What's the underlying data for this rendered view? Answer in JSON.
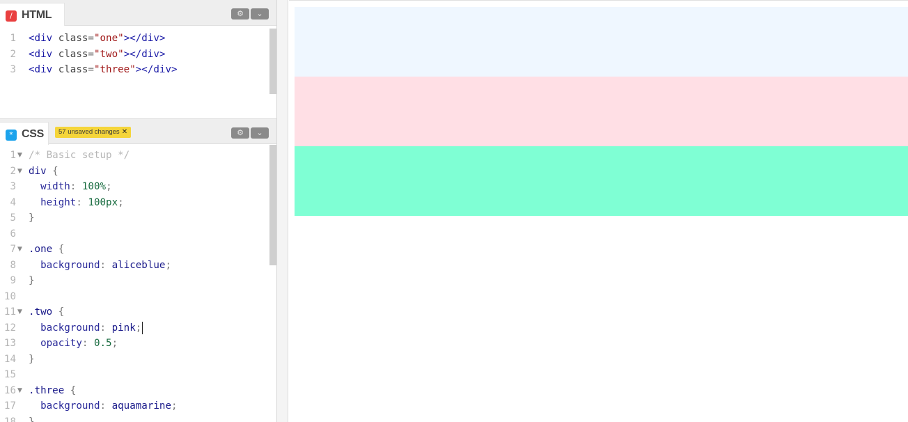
{
  "html_pane": {
    "tab_label": "HTML",
    "icon_glyph": "/",
    "icon_color": "#e94040",
    "settings_glyph": "⚙",
    "collapse_glyph": "⌄",
    "lines": [
      {
        "n": "1",
        "parts": [
          [
            "t-tag",
            "<div"
          ],
          [
            "t-attr",
            " class"
          ],
          [
            "t-pun",
            "="
          ],
          [
            "t-str",
            "\"one\""
          ],
          [
            "t-tag",
            "></div>"
          ]
        ]
      },
      {
        "n": "2",
        "parts": [
          [
            "t-tag",
            "<div"
          ],
          [
            "t-attr",
            " class"
          ],
          [
            "t-pun",
            "="
          ],
          [
            "t-str",
            "\"two\""
          ],
          [
            "t-tag",
            "></div>"
          ]
        ]
      },
      {
        "n": "3",
        "parts": [
          [
            "t-tag",
            "<div"
          ],
          [
            "t-attr",
            " class"
          ],
          [
            "t-pun",
            "="
          ],
          [
            "t-str",
            "\"three\""
          ],
          [
            "t-tag",
            "></div>"
          ]
        ]
      }
    ]
  },
  "css_pane": {
    "tab_label": "CSS",
    "icon_glyph": "*",
    "icon_color": "#1ca3ec",
    "unsaved_badge": "57 unsaved changes",
    "badge_close": "✕",
    "settings_glyph": "⚙",
    "collapse_glyph": "⌄",
    "fold_glyph": "▼",
    "lines": [
      {
        "n": "1",
        "fold": true,
        "parts": [
          [
            "t-cmt",
            "/* Basic setup */"
          ]
        ]
      },
      {
        "n": "2",
        "fold": true,
        "parts": [
          [
            "t-sel",
            "div"
          ],
          [
            "t-pun",
            " {"
          ]
        ]
      },
      {
        "n": "3",
        "parts": [
          [
            "t-prop",
            "  width"
          ],
          [
            "t-pun",
            ": "
          ],
          [
            "t-num",
            "100%"
          ],
          [
            "t-pun",
            ";"
          ]
        ]
      },
      {
        "n": "4",
        "parts": [
          [
            "t-prop",
            "  height"
          ],
          [
            "t-pun",
            ": "
          ],
          [
            "t-num",
            "100px"
          ],
          [
            "t-pun",
            ";"
          ]
        ]
      },
      {
        "n": "5",
        "parts": [
          [
            "t-pun",
            "}"
          ]
        ]
      },
      {
        "n": "6",
        "parts": []
      },
      {
        "n": "7",
        "fold": true,
        "parts": [
          [
            "t-sel",
            ".one"
          ],
          [
            "t-pun",
            " {"
          ]
        ]
      },
      {
        "n": "8",
        "parts": [
          [
            "t-prop",
            "  background"
          ],
          [
            "t-pun",
            ": "
          ],
          [
            "t-val",
            "aliceblue"
          ],
          [
            "t-pun",
            ";"
          ]
        ]
      },
      {
        "n": "9",
        "parts": [
          [
            "t-pun",
            "}"
          ]
        ]
      },
      {
        "n": "10",
        "parts": []
      },
      {
        "n": "11",
        "fold": true,
        "parts": [
          [
            "t-sel",
            ".two"
          ],
          [
            "t-pun",
            " {"
          ]
        ]
      },
      {
        "n": "12",
        "cursor": true,
        "parts": [
          [
            "t-prop",
            "  background"
          ],
          [
            "t-pun",
            ": "
          ],
          [
            "t-val",
            "pink"
          ],
          [
            "t-pun",
            ";"
          ]
        ]
      },
      {
        "n": "13",
        "parts": [
          [
            "t-prop",
            "  opacity"
          ],
          [
            "t-pun",
            ": "
          ],
          [
            "t-num",
            "0.5"
          ],
          [
            "t-pun",
            ";"
          ]
        ]
      },
      {
        "n": "14",
        "parts": [
          [
            "t-pun",
            "}"
          ]
        ]
      },
      {
        "n": "15",
        "parts": []
      },
      {
        "n": "16",
        "fold": true,
        "parts": [
          [
            "t-sel",
            ".three"
          ],
          [
            "t-pun",
            " {"
          ]
        ]
      },
      {
        "n": "17",
        "parts": [
          [
            "t-prop",
            "  background"
          ],
          [
            "t-pun",
            ": "
          ],
          [
            "t-val",
            "aquamarine"
          ],
          [
            "t-pun",
            ";"
          ]
        ]
      },
      {
        "n": "18",
        "parts": [
          [
            "t-pun",
            "}"
          ]
        ]
      }
    ]
  },
  "preview": {
    "boxes": [
      {
        "name": "one",
        "color": "#eff7ff"
      },
      {
        "name": "two",
        "color": "#ffdfe5"
      },
      {
        "name": "three",
        "color": "#7fffd4"
      }
    ]
  }
}
